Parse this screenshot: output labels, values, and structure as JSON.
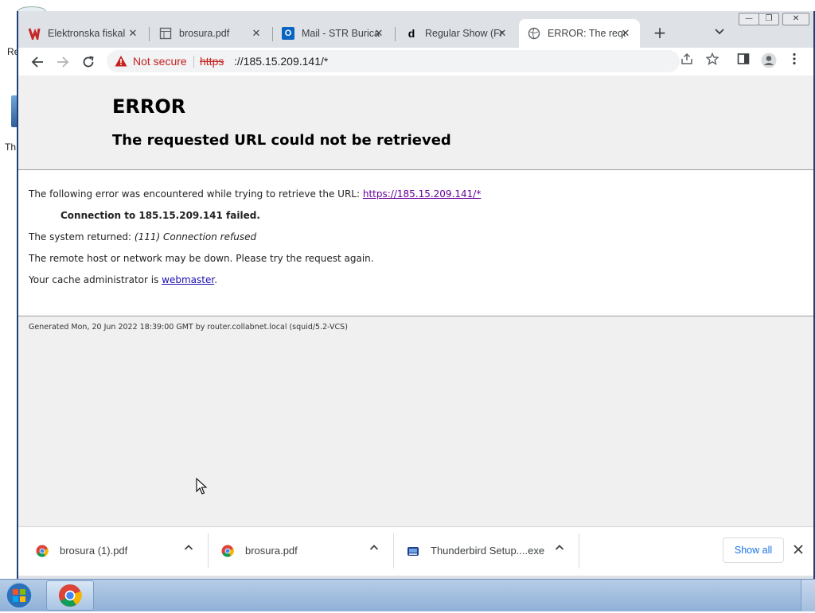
{
  "desktop": {
    "fragment_top": "Re",
    "fragment_mid": "Th"
  },
  "tabs": [
    {
      "title": "Elektronska fiskal",
      "favicon": "tax-logo-icon"
    },
    {
      "title": "brosura.pdf",
      "favicon": "pdf-doc-icon"
    },
    {
      "title": "Mail - STR Burica",
      "favicon": "outlook-icon",
      "favicon_text": "O"
    },
    {
      "title": "Regular Show (Fr",
      "favicon": "dailymotion-icon",
      "favicon_text": "d"
    },
    {
      "title": "ERROR: The requ",
      "favicon": "globe-icon"
    }
  ],
  "toolbar": {
    "not_secure": "Not secure",
    "url_scheme": "https",
    "url_rest": "://185.15.209.141/*"
  },
  "page": {
    "title": "ERROR",
    "subtitle": "The requested URL could not be retrieved",
    "line1_prefix": "The following error was encountered while trying to retrieve the URL: ",
    "line1_link": "https://185.15.209.141/*",
    "line2": "Connection to 185.15.209.141 failed.",
    "line3_prefix": "The system returned: ",
    "line3_em": "(111) Connection refused",
    "line4": "The remote host or network may be down. Please try the request again.",
    "line5_prefix": "Your cache administrator is ",
    "line5_link": "webmaster",
    "line5_suffix": ".",
    "footer": "Generated Mon, 20 Jun 2022 18:39:00 GMT by router.collabnet.local (squid/5.2-VCS)"
  },
  "downloads": {
    "items": [
      {
        "name": "brosura (1).pdf",
        "icon": "chrome-icon"
      },
      {
        "name": "brosura.pdf",
        "icon": "chrome-icon"
      },
      {
        "name": "Thunderbird Setup....exe",
        "icon": "installer-icon"
      }
    ],
    "show_all": "Show all"
  },
  "colors": {
    "not_secure": "#c5221f",
    "link": "#1a0dab",
    "visited": "#660099",
    "taskbar": "#9fbde0"
  }
}
